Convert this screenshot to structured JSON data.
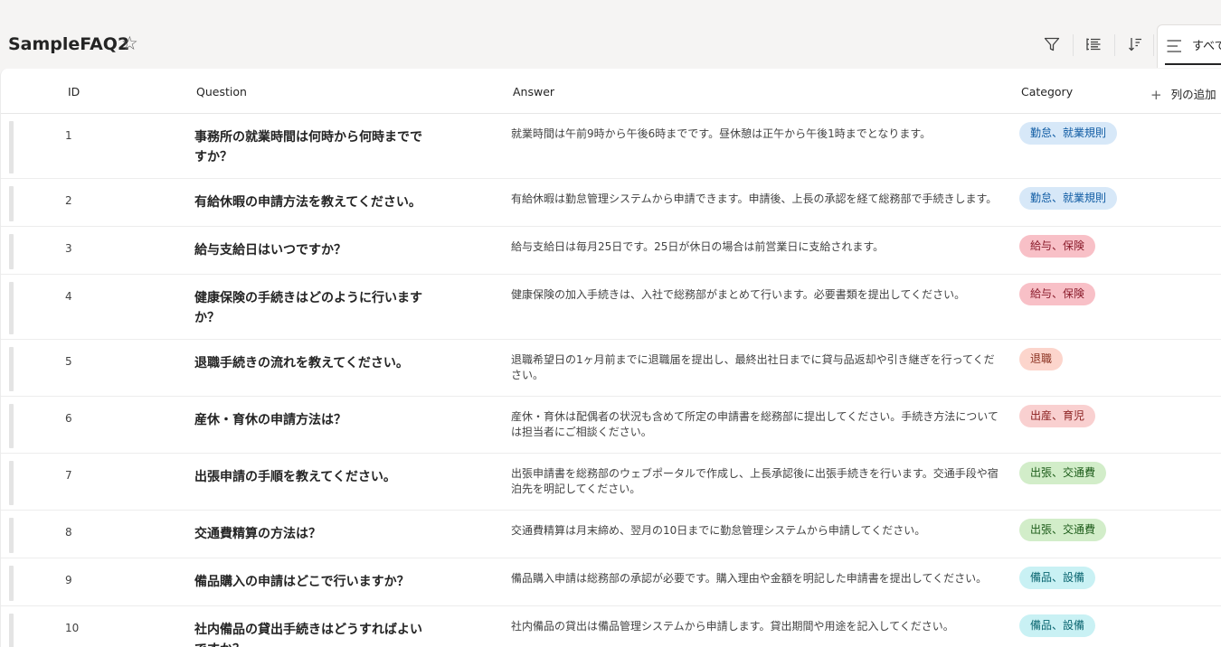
{
  "list": {
    "title": "SampleFAQ2",
    "star_icon": "star-outline-icon",
    "view_label": "すべて"
  },
  "toolbar": {
    "icons": [
      "filter-icon",
      "group-by-icon",
      "sort-icon",
      "view-options-icon"
    ]
  },
  "columns": {
    "id": "ID",
    "question": "Question",
    "answer": "Answer",
    "category": "Category",
    "add_column": "列の追加"
  },
  "category_colors": {
    "勤怠、就業規則": {
      "bg": "#d7e8f8",
      "fg": "#0f5ba3"
    },
    "給与、保険": {
      "bg": "#f8c0c7",
      "fg": "#8a1c2c"
    },
    "退職": {
      "bg": "#fcd5cc",
      "fg": "#8a3120"
    },
    "出産、育児": {
      "bg": "#f9d0d0",
      "fg": "#8a2020"
    },
    "出張、交通費": {
      "bg": "#d2edc9",
      "fg": "#1d5c1a"
    },
    "備品、設備": {
      "bg": "#c9f1f4",
      "fg": "#0a6570"
    }
  },
  "rows": [
    {
      "id": "1",
      "question": "事務所の就業時間は何時から何時までですか？",
      "answer": "就業時間は午前9時から午後6時までです。昼休憩は正午から午後1時までとなります。",
      "category": "勤怠、就業規則"
    },
    {
      "id": "2",
      "question": "有給休暇の申請方法を教えてください。",
      "answer": "有給休暇は勤怠管理システムから申請できます。申請後、上長の承認を経て総務部で手続きします。",
      "category": "勤怠、就業規則"
    },
    {
      "id": "3",
      "question": "給与支給日はいつですか？",
      "answer": "給与支給日は毎月25日です。25日が休日の場合は前営業日に支給されます。",
      "category": "給与、保険"
    },
    {
      "id": "4",
      "question": "健康保険の手続きはどのように行いますか？",
      "answer": "健康保険の加入手続きは、入社で総務部がまとめて行います。必要書類を提出してください。",
      "category": "給与、保険"
    },
    {
      "id": "5",
      "question": "退職手続きの流れを教えてください。",
      "answer": "退職希望日の1ヶ月前までに退職届を提出し、最終出社日までに貸与品返却や引き継ぎを行ってください。",
      "category": "退職"
    },
    {
      "id": "6",
      "question": "産休・育休の申請方法は？",
      "answer": "産休・育休は配偶者の状況も含めて所定の申請書を総務部に提出してください。手続き方法については担当者にご相談ください。",
      "category": "出産、育児"
    },
    {
      "id": "7",
      "question": "出張申請の手順を教えてください。",
      "answer": "出張申請書を総務部のウェブポータルで作成し、上長承認後に出張手続きを行います。交通手段や宿泊先を明記してください。",
      "category": "出張、交通費"
    },
    {
      "id": "8",
      "question": "交通費精算の方法は？",
      "answer": "交通費精算は月末締め、翌月の10日までに勤怠管理システムから申請してください。",
      "category": "出張、交通費"
    },
    {
      "id": "9",
      "question": "備品購入の申請はどこで行いますか？",
      "answer": "備品購入申請は総務部の承認が必要です。購入理由や金額を明記した申請書を提出してください。",
      "category": "備品、設備"
    },
    {
      "id": "10",
      "question": "社内備品の貸出手続きはどうすればよいですか？",
      "answer": "社内備品の貸出は備品管理システムから申請します。貸出期間や用途を記入してください。",
      "category": "備品、設備"
    }
  ]
}
